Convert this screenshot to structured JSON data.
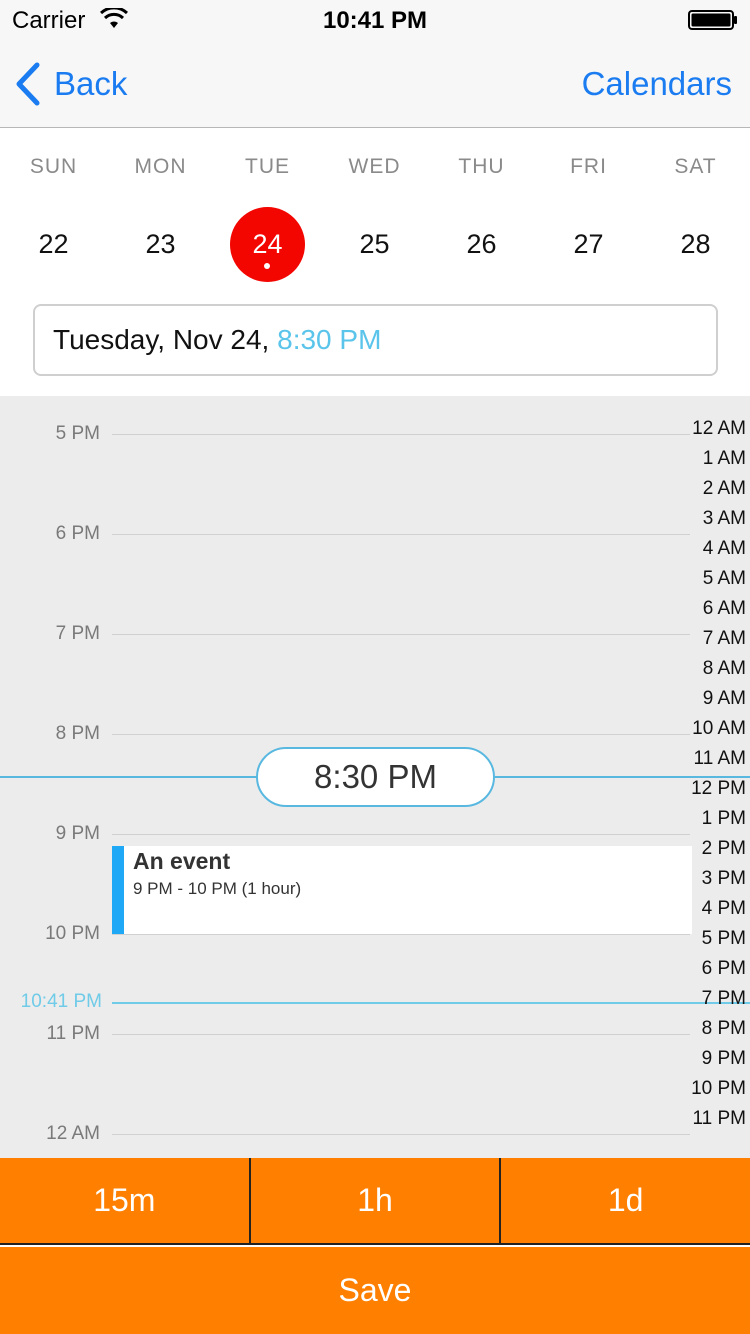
{
  "status_bar": {
    "carrier": "Carrier",
    "time": "10:41 PM"
  },
  "nav": {
    "back_label": "Back",
    "calendars_label": "Calendars",
    "accent_color": "#1a7cf0"
  },
  "week": {
    "days": [
      {
        "name": "SUN",
        "number": "22"
      },
      {
        "name": "MON",
        "number": "23"
      },
      {
        "name": "TUE",
        "number": "24",
        "selected": true,
        "has_event": true
      },
      {
        "name": "WED",
        "number": "25"
      },
      {
        "name": "THU",
        "number": "26"
      },
      {
        "name": "FRI",
        "number": "27"
      },
      {
        "name": "SAT",
        "number": "28"
      }
    ],
    "selected_color": "#f30500"
  },
  "date_field": {
    "date_text": "Tuesday, Nov 24,",
    "time_text": "8:30 PM"
  },
  "timeline": {
    "hours": [
      "5 PM",
      "6 PM",
      "7 PM",
      "8 PM",
      "9 PM",
      "10 PM",
      "11 PM",
      "12 AM"
    ],
    "event": {
      "title": "An event",
      "time": "9 PM - 10 PM (1 hour)",
      "color": "#1ea8f5"
    },
    "now_label": "10:41 PM",
    "selected_time": "8:30 PM",
    "ruler": [
      "12 AM",
      "1 AM",
      "2 AM",
      "3 AM",
      "4 AM",
      "5 AM",
      "6 AM",
      "7 AM",
      "8 AM",
      "9 AM",
      "10 AM",
      "11 AM",
      "12 PM",
      "1 PM",
      "2 PM",
      "3 PM",
      "4 PM",
      "5 PM",
      "6 PM",
      "7 PM",
      "8 PM",
      "9 PM",
      "10 PM",
      "11 PM"
    ]
  },
  "duration_buttons": [
    {
      "label": "15m"
    },
    {
      "label": "1h"
    },
    {
      "label": "1d"
    }
  ],
  "save_label": "Save",
  "action_color": "#ff7f00"
}
